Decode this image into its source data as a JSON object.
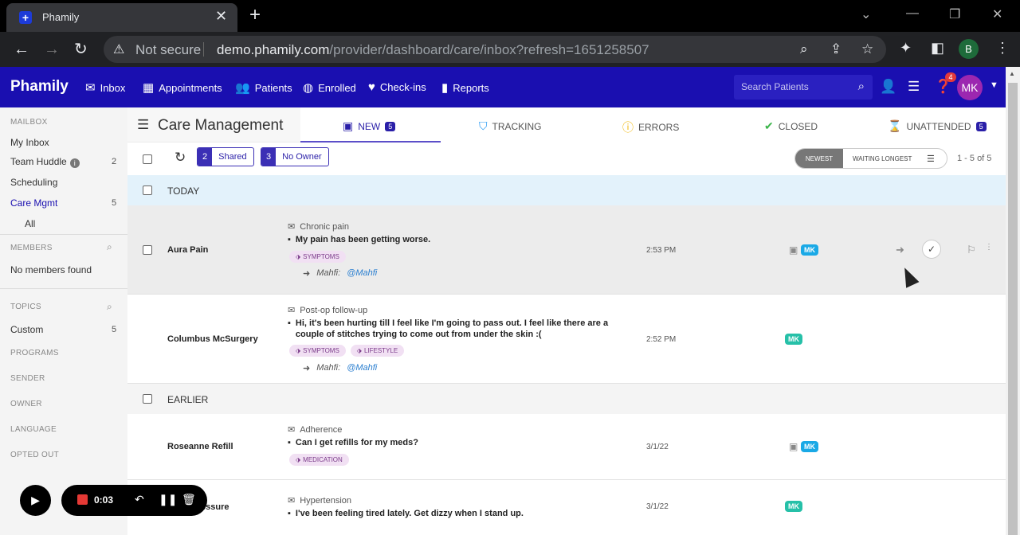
{
  "browser": {
    "tab_title": "Phamily",
    "not_secure": "Not secure",
    "url_host": "demo.phamily.com",
    "url_path": "/provider/dashboard/care/inbox?refresh=1651258507",
    "profile_initial": "B"
  },
  "header": {
    "brand": "Phamily",
    "nav": [
      "Inbox",
      "Appointments",
      "Patients",
      "Enrolled",
      "Check-ins",
      "Reports"
    ],
    "search_placeholder": "Search Patients",
    "notif_count": "4",
    "avatar": "MK"
  },
  "sidebar": {
    "mailbox_label": "MAILBOX",
    "items": [
      {
        "label": "My Inbox",
        "count": ""
      },
      {
        "label": "Team Huddle",
        "count": "2"
      },
      {
        "label": "Scheduling",
        "count": ""
      },
      {
        "label": "Care Mgmt",
        "count": "5"
      },
      {
        "label": "All",
        "count": ""
      }
    ],
    "members_label": "MEMBERS",
    "no_members": "No members found",
    "topics_label": "TOPICS",
    "custom_label": "Custom",
    "custom_count": "5",
    "sections": [
      "PROGRAMS",
      "SENDER",
      "OWNER",
      "LANGUAGE",
      "OPTED OUT"
    ]
  },
  "main": {
    "title": "Care Management",
    "tabs": [
      {
        "label": "NEW",
        "count": "5"
      },
      {
        "label": "TRACKING",
        "count": ""
      },
      {
        "label": "ERRORS",
        "count": ""
      },
      {
        "label": "CLOSED",
        "count": ""
      },
      {
        "label": "UNATTENDED",
        "count": "5"
      }
    ],
    "shared_count": "2",
    "shared_label": "Shared",
    "noowner_count": "3",
    "noowner_label": "No Owner",
    "sort_newest": "NEWEST",
    "sort_waiting": "WAITING LONGEST",
    "pager": "1 - 5 of 5",
    "group_today": "TODAY",
    "group_earlier": "EARLIER"
  },
  "rows": [
    {
      "name": "Aura Pain",
      "subject": "Chronic pain",
      "message": "My pain has been getting worse.",
      "tags": [
        "SYMPTOMS"
      ],
      "assignee": "Mahfi:",
      "mention": "@Mahfi",
      "time": "2:53 PM",
      "owner": "MK"
    },
    {
      "name": "Columbus McSurgery",
      "subject": "Post-op follow-up",
      "message": "Hi, it's been hurting till I feel like I'm going to pass out. I feel like there are a couple of stitches trying to come out from under the skin :(",
      "tags": [
        "SYMPTOMS",
        "LIFESTYLE"
      ],
      "assignee": "Mahfi:",
      "mention": "@Mahfi",
      "time": "2:52 PM",
      "owner": "MK"
    },
    {
      "name": "Roseanne Refill",
      "subject": "Adherence",
      "message": "Can I get refills for my meds?",
      "tags": [
        "MEDICATION"
      ],
      "time": "3/1/22",
      "owner": "MK"
    },
    {
      "name": "essure",
      "subject": "Hypertension",
      "message": "I've been feeling tired lately. Get dizzy when I stand up.",
      "time": "3/1/22",
      "owner": "MK"
    }
  ],
  "recorder": {
    "time": "0:03"
  }
}
